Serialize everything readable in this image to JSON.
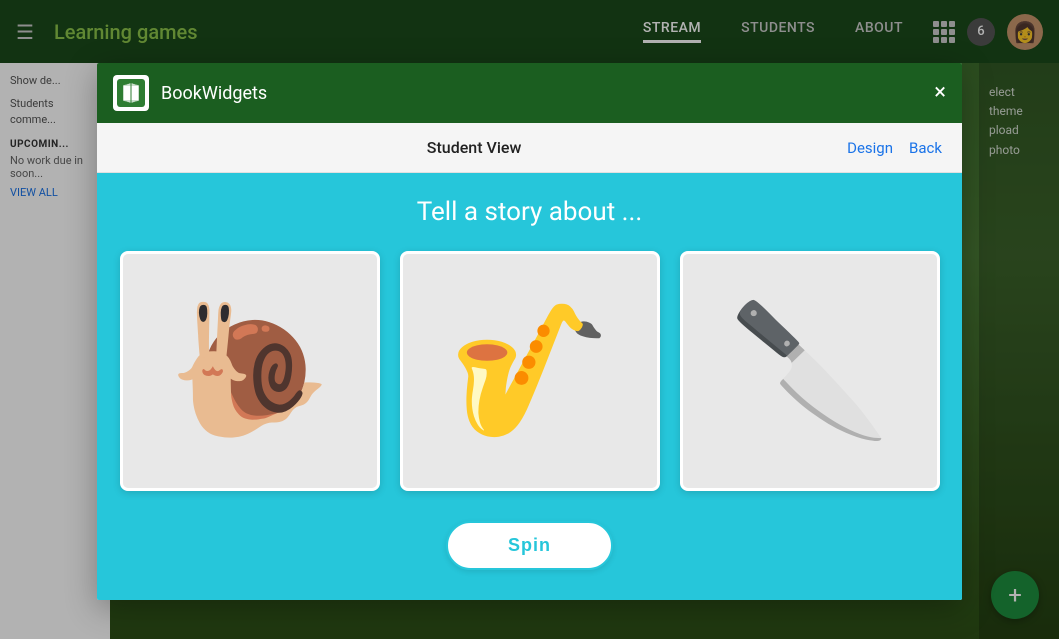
{
  "app": {
    "title": "Learning games",
    "nav": {
      "links": [
        {
          "label": "STREAM",
          "active": true
        },
        {
          "label": "STUDENTS",
          "active": false
        },
        {
          "label": "ABOUT",
          "active": false
        }
      ],
      "badge_count": "6",
      "hamburger": "☰"
    }
  },
  "left_panel": {
    "show_details_label": "Show de...",
    "students_comment_label": "Students\ncomme...",
    "upcoming_section": "UPCOMIN...",
    "no_work_label": "No work due in soon...",
    "view_all": "VIEW ALL"
  },
  "right_sidebar": {
    "select_theme": "elect theme",
    "upload_photo": "pload photo"
  },
  "modal": {
    "header": {
      "brand": "BookWidgets",
      "close_label": "×"
    },
    "subheader": {
      "view_title": "Student View",
      "design_link": "Design",
      "back_link": "Back"
    },
    "story_title": "Tell a story about ...",
    "images": [
      {
        "emoji": "🐌",
        "alt": "snail"
      },
      {
        "emoji": "🎷",
        "alt": "saxophone"
      },
      {
        "emoji": "🔪",
        "alt": "knife"
      }
    ],
    "spin_button": "Spin"
  },
  "fab": {
    "label": "+"
  },
  "help": {
    "label": "?"
  }
}
